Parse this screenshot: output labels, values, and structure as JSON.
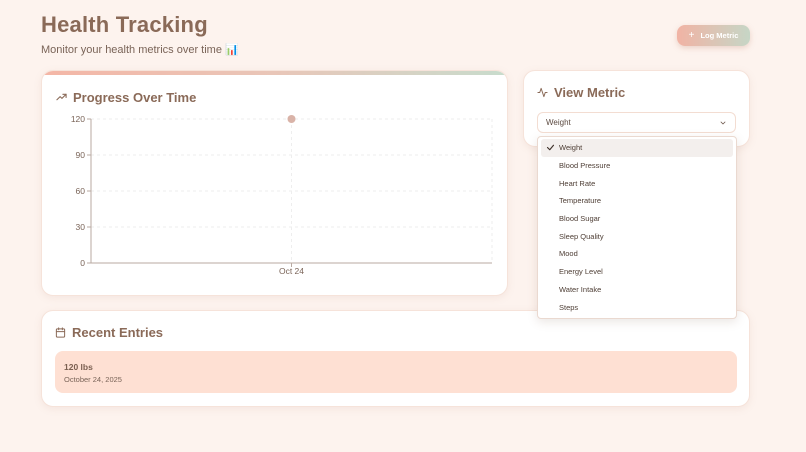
{
  "header": {
    "title": "Health Tracking",
    "subtitle": "Monitor your health metrics over time",
    "subtitle_emoji": "📊",
    "log_button": "Log Metric",
    "log_button_icon": "plus-icon"
  },
  "progress": {
    "title": "Progress Over Time",
    "icon": "trending-up-icon"
  },
  "chart_data": {
    "type": "line",
    "categories": [
      "Oct 24"
    ],
    "series": [
      {
        "values": [
          120
        ]
      }
    ],
    "ylim": [
      0,
      120
    ],
    "yticks": [
      0,
      30,
      60,
      90,
      120
    ],
    "grid": true,
    "colors": {
      "point": "#d9b3a8",
      "axis": "#b9aaa2",
      "grid": "#eeeeee"
    }
  },
  "metric": {
    "title": "View Metric",
    "icon": "activity-icon",
    "selected": "Weight",
    "options": [
      "Weight",
      "Blood Pressure",
      "Heart Rate",
      "Temperature",
      "Blood Sugar",
      "Sleep Quality",
      "Mood",
      "Energy Level",
      "Water Intake",
      "Steps"
    ]
  },
  "entries": {
    "title": "Recent Entries",
    "icon": "calendar-icon",
    "items": [
      {
        "value": "120 lbs",
        "date": "October 24, 2025"
      }
    ]
  },
  "colors": {
    "background": "#fdf3ee",
    "accent_start": "#f1b3a4",
    "accent_end": "#c6d6c6",
    "entry_bg": "#fee0d3",
    "text": "#8a6a58"
  }
}
